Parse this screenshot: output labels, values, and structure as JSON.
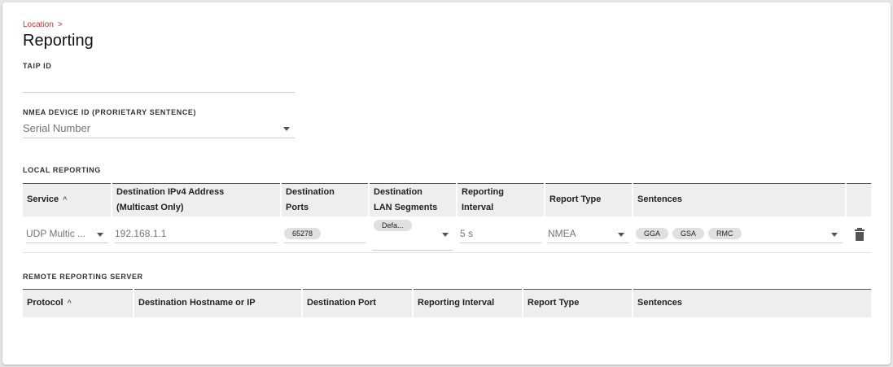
{
  "breadcrumb": {
    "parent": "Location",
    "chevron": ">"
  },
  "page_title": "Reporting",
  "taip": {
    "label": "TAIP ID",
    "value": ""
  },
  "nmea_device": {
    "label": "NMEA DEVICE ID (PRORIETARY SENTENCE)",
    "value": "Serial Number"
  },
  "local_reporting": {
    "section_label": "LOCAL REPORTING",
    "headers": {
      "service": "Service",
      "dest_ip_1": "Destination IPv4 Address",
      "dest_ip_2": "(Multicast Only)",
      "ports_1": "Destination",
      "ports_2": "Ports",
      "lan_1": "Destination",
      "lan_2": "LAN Segments",
      "interval_1": "Reporting",
      "interval_2": "Interval",
      "report_type": "Report Type",
      "sentences": "Sentences"
    },
    "sort_indicator": "^",
    "row": {
      "service": "UDP Multic ...",
      "dest_ip": "192.168.1.1",
      "port_chip": "65278",
      "lan_chip": "Defa...",
      "interval": "5 s",
      "report_type": "NMEA",
      "sentences": [
        "GGA",
        "GSA",
        "RMC"
      ]
    }
  },
  "remote_reporting": {
    "section_label": "REMOTE REPORTING SERVER",
    "headers": {
      "protocol": "Protocol",
      "hostname": "Destination Hostname or IP",
      "port": "Destination Port",
      "interval": "Reporting Interval",
      "report_type": "Report Type",
      "sentences": "Sentences"
    },
    "sort_indicator": "^"
  },
  "colors": {
    "accent": "#d32f2f",
    "header_bg": "#eeeeee"
  }
}
